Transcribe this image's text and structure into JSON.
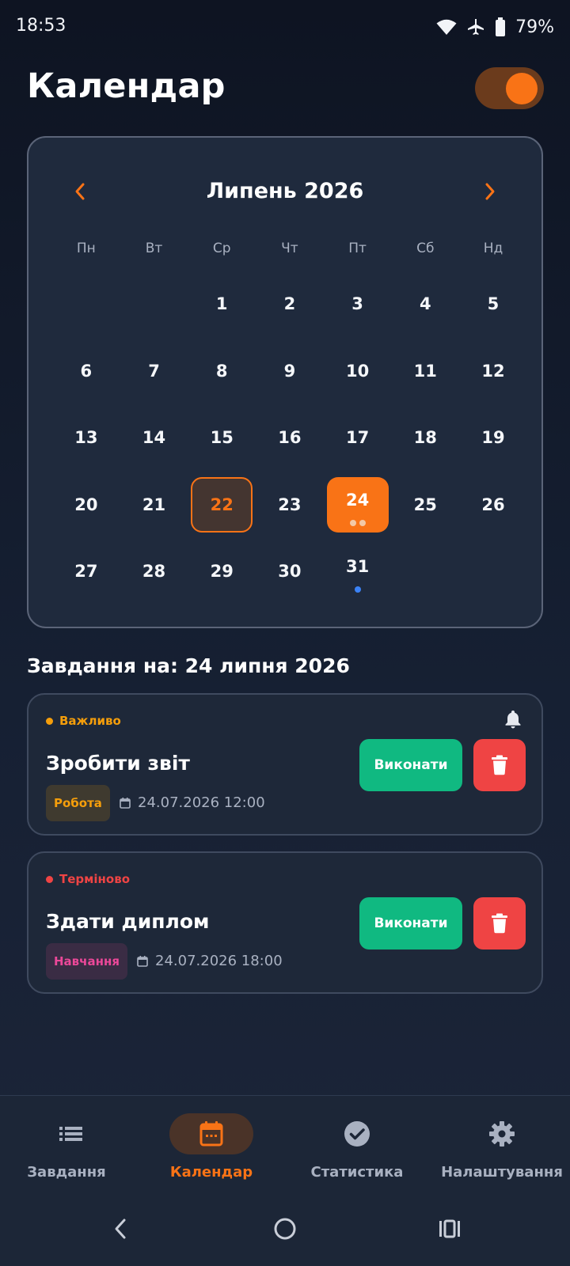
{
  "status_bar": {
    "time": "18:53",
    "battery": "79%"
  },
  "header": {
    "title": "Календар"
  },
  "calendar": {
    "month_title": "Липень 2026",
    "weekdays": [
      "Пн",
      "Вт",
      "Ср",
      "Чт",
      "Пт",
      "Сб",
      "Нд"
    ],
    "leading_blanks": 2,
    "days": [
      "1",
      "2",
      "3",
      "4",
      "5",
      "6",
      "7",
      "8",
      "9",
      "10",
      "11",
      "12",
      "13",
      "14",
      "15",
      "16",
      "17",
      "18",
      "19",
      "20",
      "21",
      "22",
      "23",
      "24",
      "25",
      "26",
      "27",
      "28",
      "29",
      "30",
      "31"
    ],
    "today": "22",
    "selected": "24",
    "selected_dot_colors": [
      "#f3c9a6",
      "#f3c9a6"
    ],
    "dot_day": "31",
    "dot_day_color": "#3b82f6"
  },
  "section": {
    "title": "Завдання на: 24 липня 2026"
  },
  "tasks": [
    {
      "priority": "Важливо",
      "priority_color": "#f59e0b",
      "title": "Зробити звіт",
      "category": "Робота",
      "category_color": "#f59e0b",
      "category_bg": "#3f3a2f",
      "datetime": "24.07.2026 12:00",
      "complete_label": "Виконати",
      "has_bell": true
    },
    {
      "priority": "Терміново",
      "priority_color": "#ef4444",
      "title": "Здати диплом",
      "category": "Навчання",
      "category_color": "#ec4899",
      "category_bg": "#3a2c44",
      "datetime": "24.07.2026 18:00",
      "complete_label": "Виконати",
      "has_bell": false
    }
  ],
  "bottom_nav": {
    "items": [
      {
        "label": "Завдання",
        "icon": "list-icon"
      },
      {
        "label": "Календар",
        "icon": "calendar-icon"
      },
      {
        "label": "Статистика",
        "icon": "check-circle-icon"
      },
      {
        "label": "Налаштування",
        "icon": "gear-icon"
      }
    ],
    "active_index": 1
  },
  "colors": {
    "accent": "#f97316",
    "success": "#10b981",
    "danger": "#ef4444"
  }
}
